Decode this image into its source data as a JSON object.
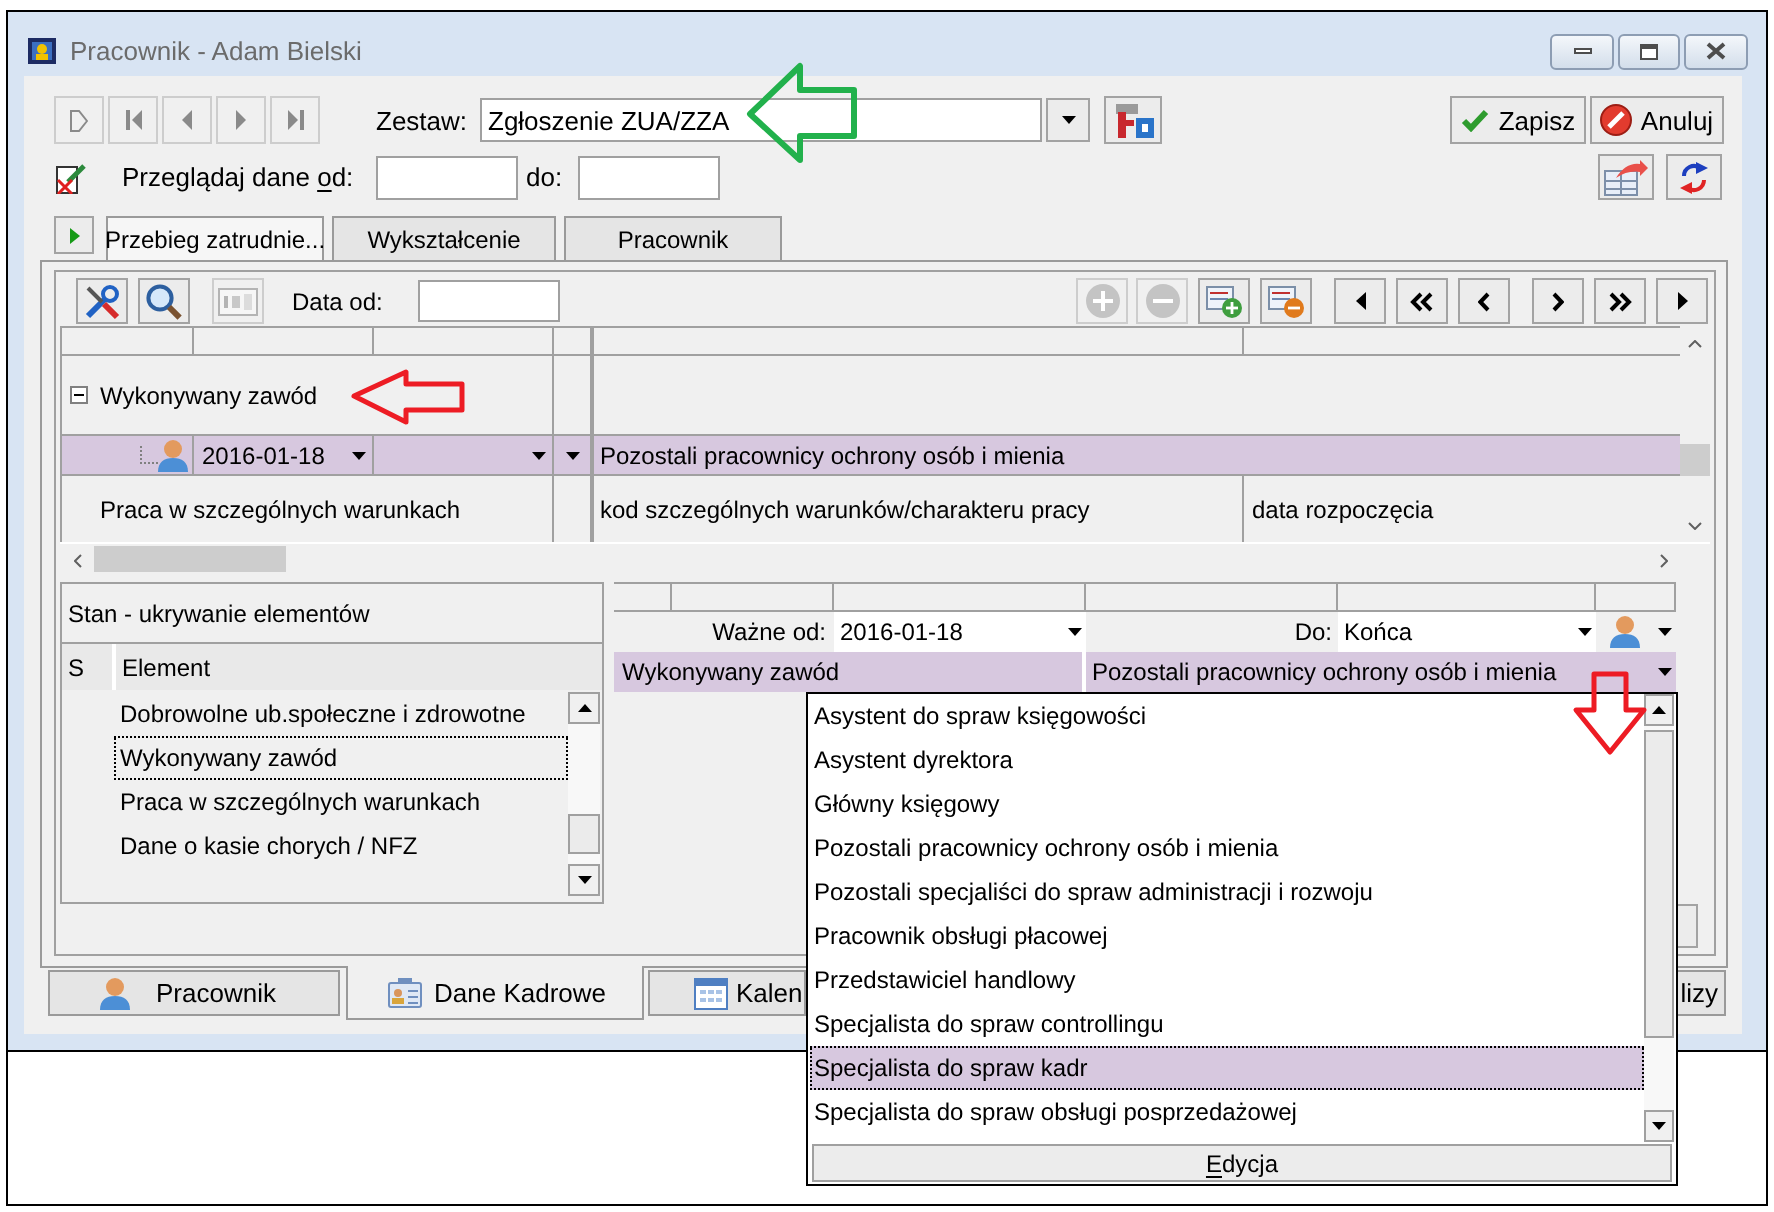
{
  "window": {
    "title": "Pracownik - Adam Bielski"
  },
  "record_nav": [
    {
      "kind": "new",
      "disabled": true
    },
    {
      "kind": "first",
      "disabled": true
    },
    {
      "kind": "prev",
      "disabled": true
    },
    {
      "kind": "next",
      "disabled": true
    },
    {
      "kind": "last",
      "disabled": true
    }
  ],
  "set": {
    "label": "Zestaw:",
    "value": "Zgłoszenie ZUA/ZZA"
  },
  "actions": [
    {
      "kind": "save",
      "label": "Zapisz"
    },
    {
      "kind": "cancel",
      "label": "Anuluj"
    }
  ],
  "date_range": {
    "label_parts": [
      {
        "text": "Przeglądaj dane ",
        "underlined": false
      },
      {
        "text": "o",
        "underlined": true
      },
      {
        "text": "d:",
        "underlined": false
      }
    ],
    "to_label": "do:"
  },
  "tabs": [
    {
      "label": "Przebieg zatrudnie...",
      "selected": true
    },
    {
      "label": "Wykształcenie",
      "selected": false
    },
    {
      "label": "Pracownik",
      "selected": false
    }
  ],
  "grid": {
    "tools": [
      {
        "kind": "tools",
        "disabled": false
      },
      {
        "kind": "search",
        "disabled": false
      },
      {
        "kind": "calculator",
        "disabled": true
      }
    ],
    "date_label": "Data od:",
    "actions": [
      {
        "kind": "add",
        "disabled": true
      },
      {
        "kind": "remove",
        "disabled": true
      },
      {
        "kind": "add_row",
        "disabled": false
      },
      {
        "kind": "remove_row",
        "disabled": false
      },
      {
        "kind": "prev",
        "disabled": false
      },
      {
        "kind": "first",
        "disabled": false
      },
      {
        "kind": "back",
        "disabled": false
      },
      {
        "kind": "forward",
        "disabled": false
      },
      {
        "kind": "last",
        "disabled": false
      },
      {
        "kind": "next",
        "disabled": false
      }
    ],
    "rows": [
      {
        "kind": "group",
        "label": "Wykonywany zawód",
        "expanded": true,
        "children": [
          {
            "kind": "entry",
            "date": "2016-01-18",
            "value": "Pozostali pracownicy ochrony osób i mienia",
            "selected": true
          }
        ]
      },
      {
        "kind": "section",
        "label": "Praca w szczególnych warunkach",
        "cells": [
          "kod szczególnych warunków/charakteru pracy",
          "data rozpoczęcia"
        ]
      }
    ]
  },
  "state_panel": {
    "title": "Stan - ukrywanie elementów",
    "columns": [
      "S",
      "Element"
    ],
    "items": [
      {
        "label": "Dobrowolne ub.społeczne i zdrowotne",
        "selected": false
      },
      {
        "label": "Wykonywany zawód",
        "selected": true
      },
      {
        "label": "Praca w szczególnych warunkach",
        "selected": false
      },
      {
        "label": "Dane o kasie chorych / NFZ",
        "selected": false
      }
    ]
  },
  "detail": {
    "valid_from_label": "Ważne od:",
    "valid_from": "2016-01-18",
    "to_label": "Do:",
    "to": "Końca",
    "field": {
      "label": "Wykonywany zawód",
      "value": "Pozostali pracownicy ochrony osób i mienia",
      "selected": true
    }
  },
  "dropdown": {
    "items": [
      {
        "label": "Asystent do spraw księgowości",
        "selected": false
      },
      {
        "label": "Asystent dyrektora",
        "selected": false
      },
      {
        "label": "Główny księgowy",
        "selected": false
      },
      {
        "label": "Pozostali pracownicy ochrony osób i mienia",
        "selected": false
      },
      {
        "label": "Pozostali specjaliści do spraw administracji i rozwoju",
        "selected": false
      },
      {
        "label": "Pracownik obsługi płacowej",
        "selected": false
      },
      {
        "label": "Przedstawiciel handlowy",
        "selected": false
      },
      {
        "label": "Specjalista do spraw controllingu",
        "selected": false
      },
      {
        "label": "Specjalista do spraw kadr",
        "selected": true
      },
      {
        "label": "Specjalista do spraw obsługi posprzedażowej",
        "selected": false
      }
    ],
    "footer_parts": [
      {
        "text": "E",
        "underlined": true
      },
      {
        "text": "dycja",
        "underlined": false
      }
    ]
  },
  "bottom_tabs": [
    {
      "kind": "person",
      "label": "Pracownik",
      "selected": false
    },
    {
      "kind": "card",
      "label": "Dane Kadrowe",
      "selected": true
    },
    {
      "kind": "calendar",
      "label": "Kalen",
      "selected": false
    },
    {
      "kind": "plain",
      "label": "lizy",
      "selected": false
    }
  ]
}
